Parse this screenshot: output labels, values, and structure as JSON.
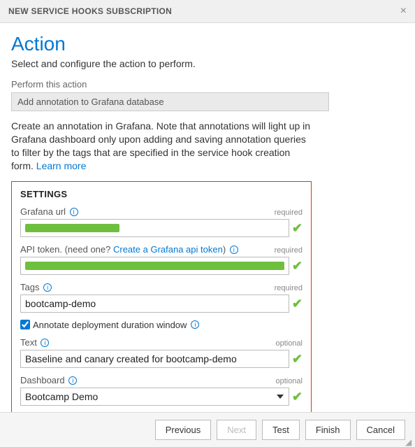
{
  "titlebar": {
    "title": "NEW SERVICE HOOKS SUBSCRIPTION"
  },
  "header": {
    "heading": "Action",
    "subtitle": "Select and configure the action to perform."
  },
  "perform": {
    "label": "Perform this action",
    "value": "Add annotation to Grafana database"
  },
  "description": {
    "text": "Create an annotation in Grafana. Note that annotations will light up in Grafana dashboard only upon adding and saving annotation queries to filter by the tags that are specified in the service hook creation form. ",
    "learn_more": "Learn more"
  },
  "settings": {
    "title": "SETTINGS",
    "fields": {
      "grafana_url": {
        "label": "Grafana url",
        "required_text": "required",
        "value_redacted": true
      },
      "api_token": {
        "label_prefix": "API token. (need one? ",
        "link_text": "Create a Grafana api token",
        "label_suffix": ")",
        "required_text": "required",
        "value_redacted": true
      },
      "tags": {
        "label": "Tags",
        "required_text": "required",
        "value": "bootcamp-demo"
      },
      "annotate_checkbox": {
        "label": "Annotate deployment duration window",
        "checked": true
      },
      "text_field": {
        "label": "Text",
        "required_text": "optional",
        "value": "Baseline and canary created for bootcamp-demo"
      },
      "dashboard": {
        "label": "Dashboard",
        "required_text": "optional",
        "value": "Bootcamp Demo"
      }
    }
  },
  "footer": {
    "previous": "Previous",
    "next": "Next",
    "test": "Test",
    "finish": "Finish",
    "cancel": "Cancel"
  }
}
